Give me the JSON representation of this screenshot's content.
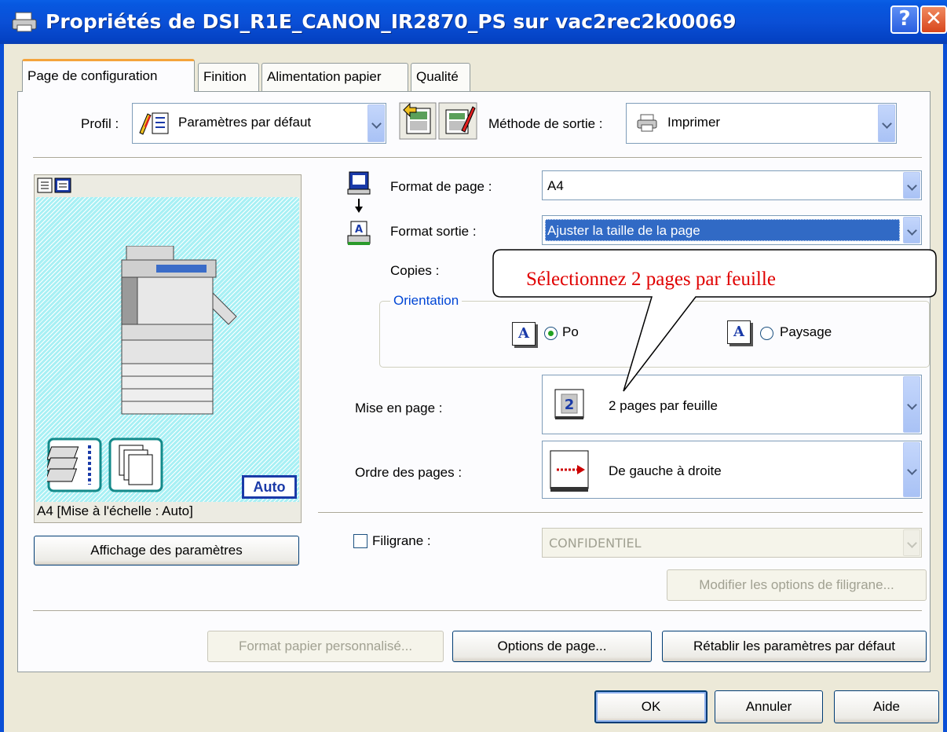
{
  "window": {
    "title": "Propriétés de DSI_R1E_CANON_IR2870_PS sur vac2rec2k00069",
    "help_label": "?",
    "close_label": "✕"
  },
  "tabs": [
    {
      "label": "Page de configuration",
      "active": true
    },
    {
      "label": "Finition",
      "active": false
    },
    {
      "label": "Alimentation papier",
      "active": false
    },
    {
      "label": "Qualité",
      "active": false
    }
  ],
  "profile": {
    "label": "Profil :",
    "value": "Paramètres par défaut",
    "output_method_label": "Méthode de sortie :",
    "output_method_value": "Imprimer"
  },
  "preview": {
    "caption": "A4 [Mise à l'échelle : Auto]",
    "auto_badge": "Auto",
    "settings_button": "Affichage des paramètres"
  },
  "page_size": {
    "label": "Format de page :",
    "value": "A4"
  },
  "output_size": {
    "label": "Format sortie :",
    "value": "Ajuster la taille de la page"
  },
  "copies": {
    "label": "Copies :"
  },
  "orientation": {
    "group_label": "Orientation",
    "portrait_label": "Po",
    "landscape_label": "Paysage",
    "selected": "portrait"
  },
  "layout": {
    "label": "Mise en page :",
    "value": "2 pages par feuille",
    "icon_digit": "2"
  },
  "page_order": {
    "label": "Ordre des pages :",
    "value": "De gauche à droite"
  },
  "watermark": {
    "label": "Filigrane :",
    "value": "CONFIDENTIEL",
    "checked": false,
    "options_button": "Modifier les options de filigrane..."
  },
  "buttons": {
    "custom_paper": "Format papier personnalisé...",
    "page_options": "Options de page...",
    "restore_defaults": "Rétablir les paramètres par défaut",
    "ok": "OK",
    "cancel": "Annuler",
    "help": "Aide"
  },
  "callout": {
    "text": "Sélectionnez 2 pages par feuille"
  },
  "colors": {
    "titlebar": "#0a4fd6",
    "active_tab_accent": "#f4a43c",
    "selection": "#316ac5",
    "preview_bg": "#a8f0f4",
    "callout_text": "#e00000"
  }
}
